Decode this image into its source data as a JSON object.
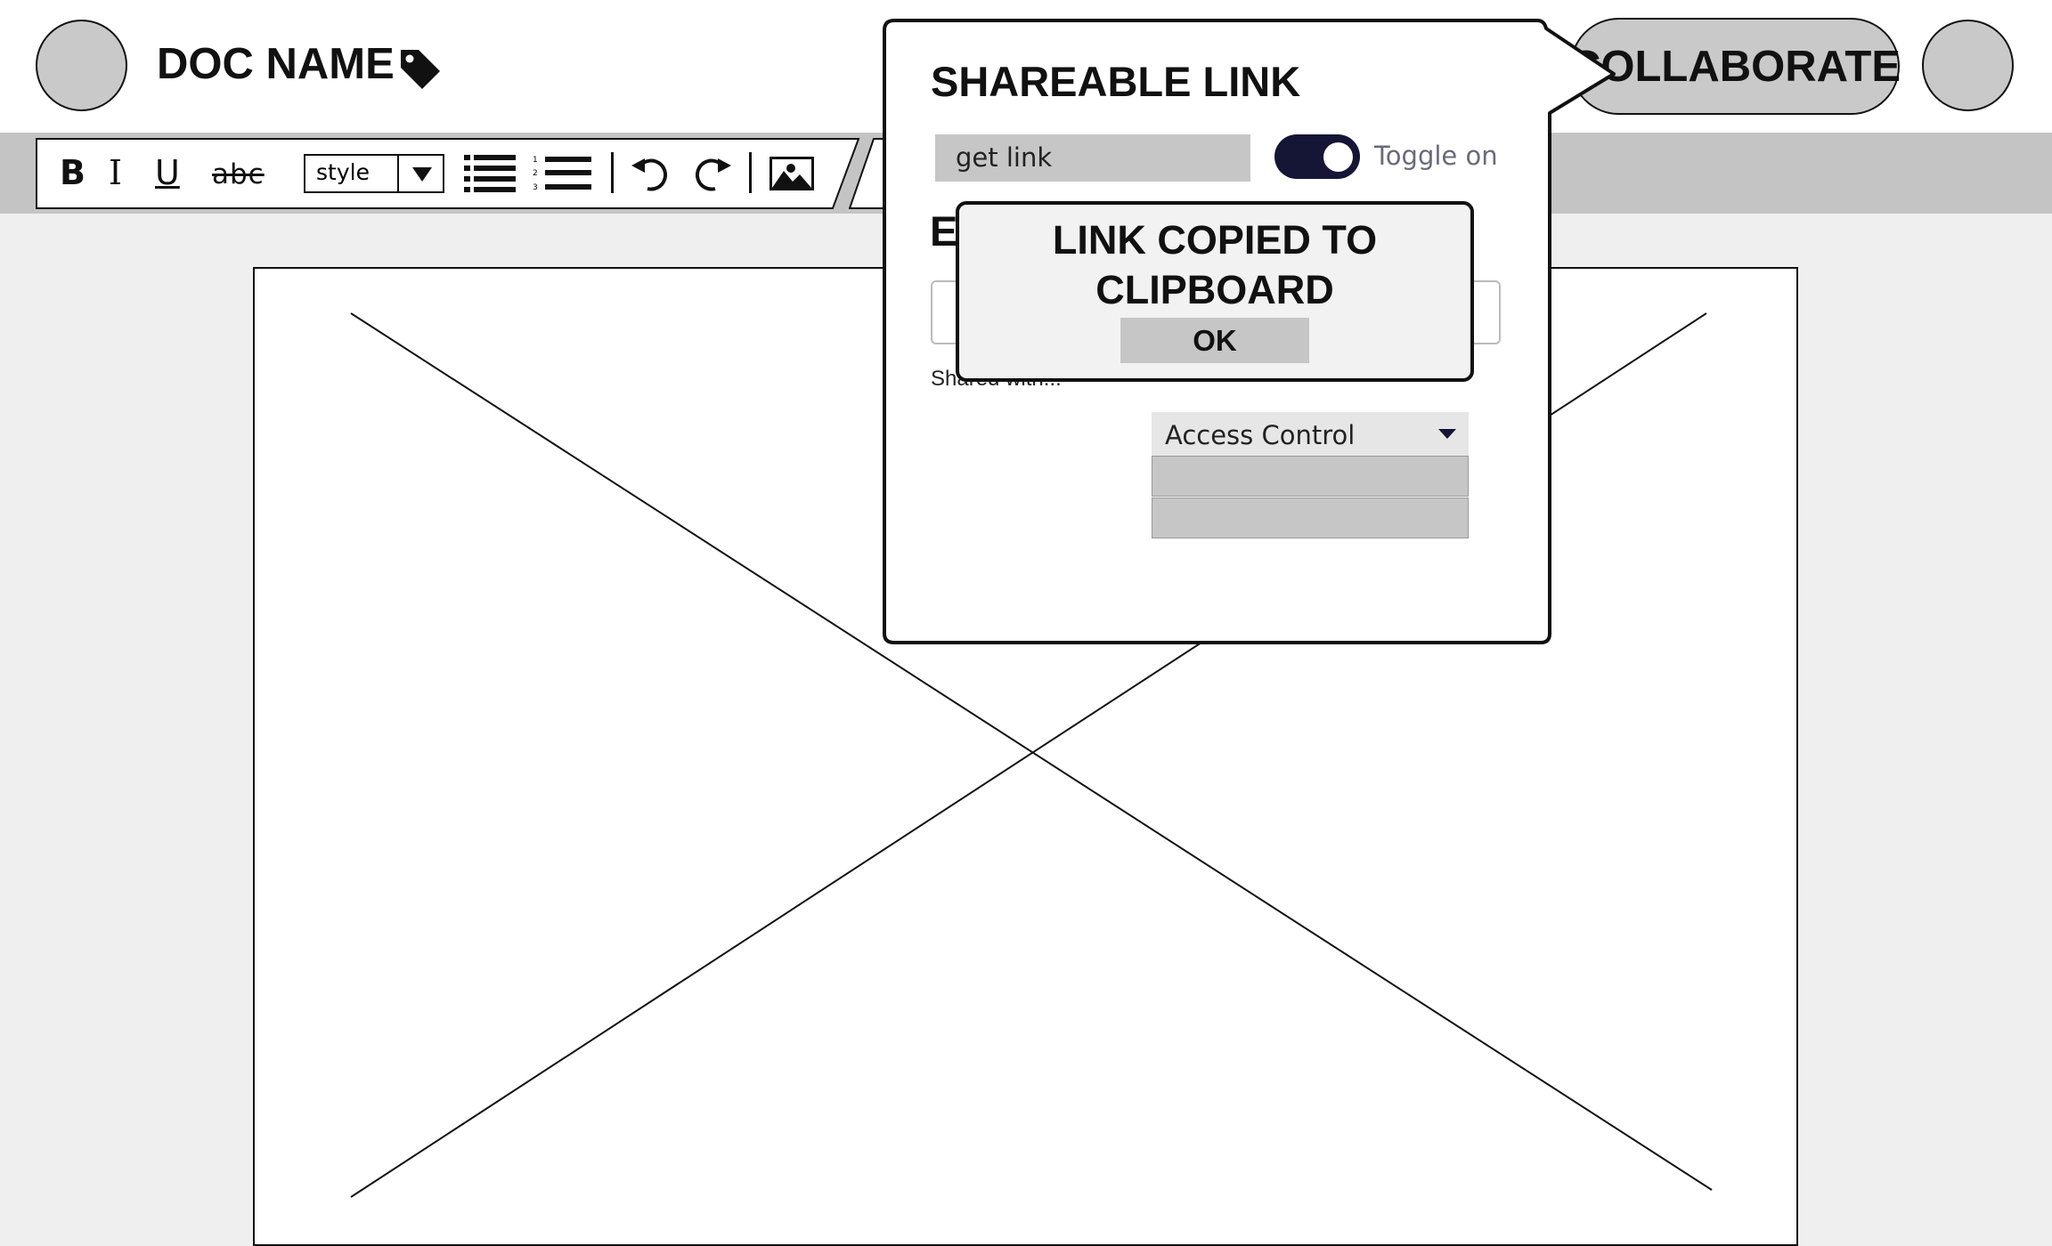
{
  "header": {
    "doc_name": "DOC NAME",
    "collaborate_label": "COLLABORATE"
  },
  "toolbar": {
    "bold": "B",
    "italic": "I",
    "underline": "U",
    "strike": "abc",
    "style_value": "style",
    "list_numbers": [
      "1",
      "2",
      "3"
    ],
    "icons": [
      "bold-icon",
      "italic-icon",
      "underline-icon",
      "strikethrough-icon",
      "chevron-down-icon",
      "bulleted-list-icon",
      "numbered-list-icon",
      "undo-icon",
      "redo-icon",
      "insert-image-icon"
    ]
  },
  "share_popover": {
    "title": "SHAREABLE LINK",
    "link_field_value": "get link",
    "toggle_label": "Toggle on",
    "toggle_on": true,
    "hidden_heading_initial": "E",
    "shared_with_label": "Shared with...",
    "access_control_label": "Access Control",
    "access_options": [
      "",
      ""
    ]
  },
  "copied_dialog": {
    "message": "LINK COPIED TO CLIPBOARD",
    "ok_label": "OK"
  },
  "colors": {
    "toolbar_band": "#c4c4c4",
    "canvas_background": "#efefef",
    "toggle_track": "#151536",
    "field_fill": "#c6c6c6"
  }
}
